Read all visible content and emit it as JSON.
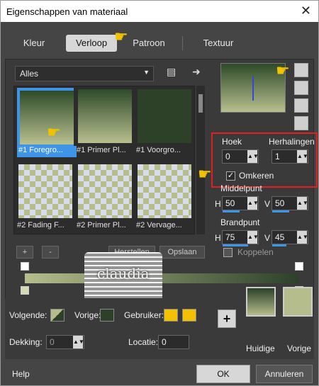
{
  "window": {
    "title": "Eigenschappen van materiaal"
  },
  "tabs": [
    {
      "label": "Kleur"
    },
    {
      "label": "Verloop"
    },
    {
      "label": "Patroon"
    },
    {
      "label": "Textuur"
    }
  ],
  "dropdown": {
    "value": "Alles"
  },
  "gradients": [
    {
      "caption": "#1 Foregro..."
    },
    {
      "caption": "#1 Primer Pl..."
    },
    {
      "caption": "#1 Voorgro..."
    },
    {
      "caption": "#2 Fading F..."
    },
    {
      "caption": "#2 Primer Pl..."
    },
    {
      "caption": "#2 Vervage..."
    }
  ],
  "settings": {
    "hoek_label": "Hoek",
    "hoek_value": "0",
    "herhalingen_label": "Herhalingen",
    "herhalingen_value": "1",
    "omkeren_label": "Omkeren",
    "middelpunt_label": "Middelpunt",
    "brandpunt_label": "Brandpunt",
    "h_label": "H",
    "v_label": "V",
    "mid_h": "50",
    "mid_v": "50",
    "brand_h": "75",
    "brand_v": "45",
    "koppelen_label": "Koppelen"
  },
  "stopbar": {
    "add": "+",
    "remove": "-",
    "reset": "Herstellen",
    "save": "Opslaan"
  },
  "colors": {
    "volgende_label": "Volgende:",
    "vorige_label": "Vorige:",
    "gebruiker_label": "Gebruiker:",
    "dekking_label": "Dekking:",
    "dekking_value": "0",
    "locatie_label": "Locatie:",
    "locatie_value": "0",
    "huidige_label": "Huidige",
    "vorige2_label": "Vorige",
    "fg": "#2c4128",
    "bg": "#b5bd8c",
    "user": "#f2c200"
  },
  "footer": {
    "help": "Help",
    "ok": "OK",
    "cancel": "Annuleren"
  },
  "watermark": "claudia"
}
